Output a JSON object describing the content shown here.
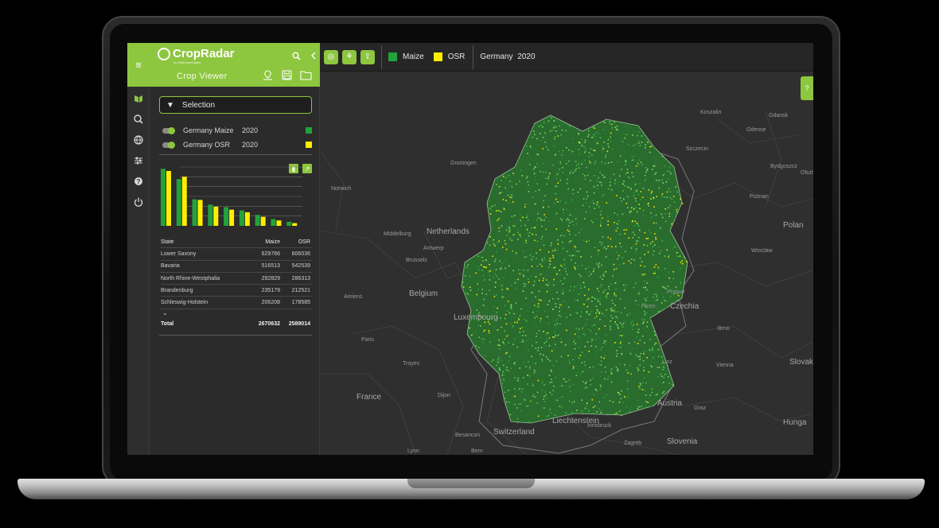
{
  "app": {
    "logo": "CropRadar",
    "logo_sub": "by KleffmannDigital",
    "panel_title": "Crop Viewer"
  },
  "colors": {
    "accent": "#8dc63f",
    "maize": "#21a33a",
    "osr": "#ffee00"
  },
  "icons": {
    "menu": "menu-icon",
    "search": "search-icon",
    "collapse": "chevron-left-icon",
    "location": "location-pin-icon",
    "save": "save-icon",
    "folder": "folder-icon",
    "rail": [
      "layers-icon",
      "zoom-search-icon",
      "globe-icon",
      "sliders-icon",
      "help-icon",
      "power-icon"
    ]
  },
  "selection": {
    "label": "Selection"
  },
  "layers": [
    {
      "name": "Germany  Maize",
      "year": "2020",
      "color": "#21a33a"
    },
    {
      "name": "Germany  OSR",
      "year": "2020",
      "color": "#ffee00"
    }
  ],
  "chart_data": {
    "type": "bar",
    "categories": [
      "Lower Saxony",
      "Bavaria",
      "North Rhine-Westphalia",
      "Brandenburg",
      "Schleswig-Holstein",
      "",
      "",
      "",
      ""
    ],
    "series": [
      {
        "name": "Maize",
        "color": "#21a33a",
        "values": [
          629766,
          516513,
          292829,
          235179,
          206208,
          170000,
          120000,
          75000,
          45000
        ]
      },
      {
        "name": "OSR",
        "color": "#ffee00",
        "values": [
          606036,
          542539,
          286313,
          212521,
          178585,
          150000,
          100000,
          60000,
          30000
        ]
      }
    ],
    "ylim": [
      0,
      650000
    ],
    "grid": true,
    "title": "",
    "xlabel": "",
    "ylabel": ""
  },
  "table": {
    "headers": [
      "State",
      "Maize",
      "OSR"
    ],
    "rows": [
      [
        "Lower Saxony",
        "629766",
        "606036"
      ],
      [
        "Bavaria",
        "516513",
        "542539"
      ],
      [
        "North Rhine-Westphalia",
        "292829",
        "286313"
      ],
      [
        "Brandenburg",
        "235179",
        "212521"
      ],
      [
        "Schleswig-Holstein",
        "206208",
        "178585"
      ]
    ],
    "more": "⌄",
    "total": [
      "Total",
      "2670632",
      "2589014"
    ]
  },
  "toolbar": {
    "legend": [
      {
        "label": "Maize",
        "color": "#21a33a"
      },
      {
        "label": "OSR",
        "color": "#ffee00"
      }
    ],
    "region": "Germany  2020"
  },
  "map": {
    "help": "?",
    "countries": [
      "Netherlands",
      "Belgium",
      "Luxembourg",
      "France",
      "Switzerland",
      "Liechtenstein",
      "Austria",
      "Czechia",
      "Polan",
      "Slovenia",
      "Slovak",
      "Hunga"
    ],
    "cities": [
      "Norwich",
      "Groningen",
      "Middelburg",
      "Brussels",
      "Antwerp",
      "Amiens",
      "Paris",
      "Troyes",
      "Dijon",
      "Besancon",
      "Lyon",
      "Bern",
      "Prague",
      "Plzen",
      "Linz",
      "Vienna",
      "Graz",
      "Brno",
      "Bydgoszcz",
      "Gdansk",
      "Poznan",
      "Wroclaw",
      "Innsbruck",
      "Zagreb",
      "Odense",
      "Szczecin",
      "Koszalin",
      "Olsztyn"
    ]
  }
}
